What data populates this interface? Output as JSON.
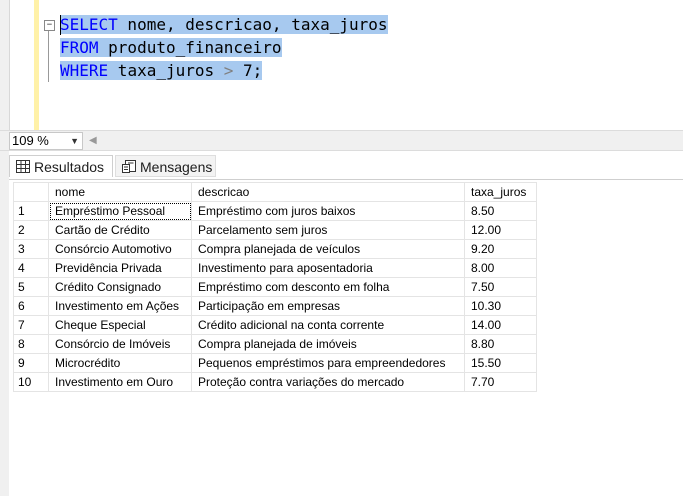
{
  "editor": {
    "collapse_symbol": "−",
    "line1": {
      "kw1": "SELECT",
      "rest": " nome, descricao, taxa_juros"
    },
    "line2": {
      "kw1": "FROM",
      "rest": " produto_financeiro"
    },
    "line3": {
      "kw1": "WHERE",
      "col": " taxa_juros ",
      "op": ">",
      "val": " 7;"
    }
  },
  "zoom": {
    "value": "109 %"
  },
  "tabs": {
    "results": "Resultados",
    "messages": "Mensagens"
  },
  "grid": {
    "columns": [
      "nome",
      "descricao",
      "taxa_juros"
    ],
    "rows": [
      [
        "1",
        "Empréstimo Pessoal",
        "Empréstimo com juros baixos",
        "8.50"
      ],
      [
        "2",
        "Cartão de Crédito",
        "Parcelamento sem juros",
        "12.00"
      ],
      [
        "3",
        "Consórcio Automotivo",
        "Compra planejada de veículos",
        "9.20"
      ],
      [
        "4",
        "Previdência Privada",
        "Investimento para aposentadoria",
        "8.00"
      ],
      [
        "5",
        "Crédito Consignado",
        "Empréstimo com desconto em folha",
        "7.50"
      ],
      [
        "6",
        "Investimento em Ações",
        "Participação em empresas",
        "10.30"
      ],
      [
        "7",
        "Cheque Especial",
        "Crédito adicional na conta corrente",
        "14.00"
      ],
      [
        "8",
        "Consórcio de Imóveis",
        "Compra planejada de imóveis",
        "8.80"
      ],
      [
        "9",
        "Microcrédito",
        "Pequenos empréstimos para empreendedores",
        "15.50"
      ],
      [
        "10",
        "Investimento em Ouro",
        "Proteção contra variações do mercado",
        "7.70"
      ]
    ]
  },
  "colors": {
    "selection": "#a7c9ef",
    "keyword": "#0000ff",
    "selection_margin": "#fff1a8"
  }
}
